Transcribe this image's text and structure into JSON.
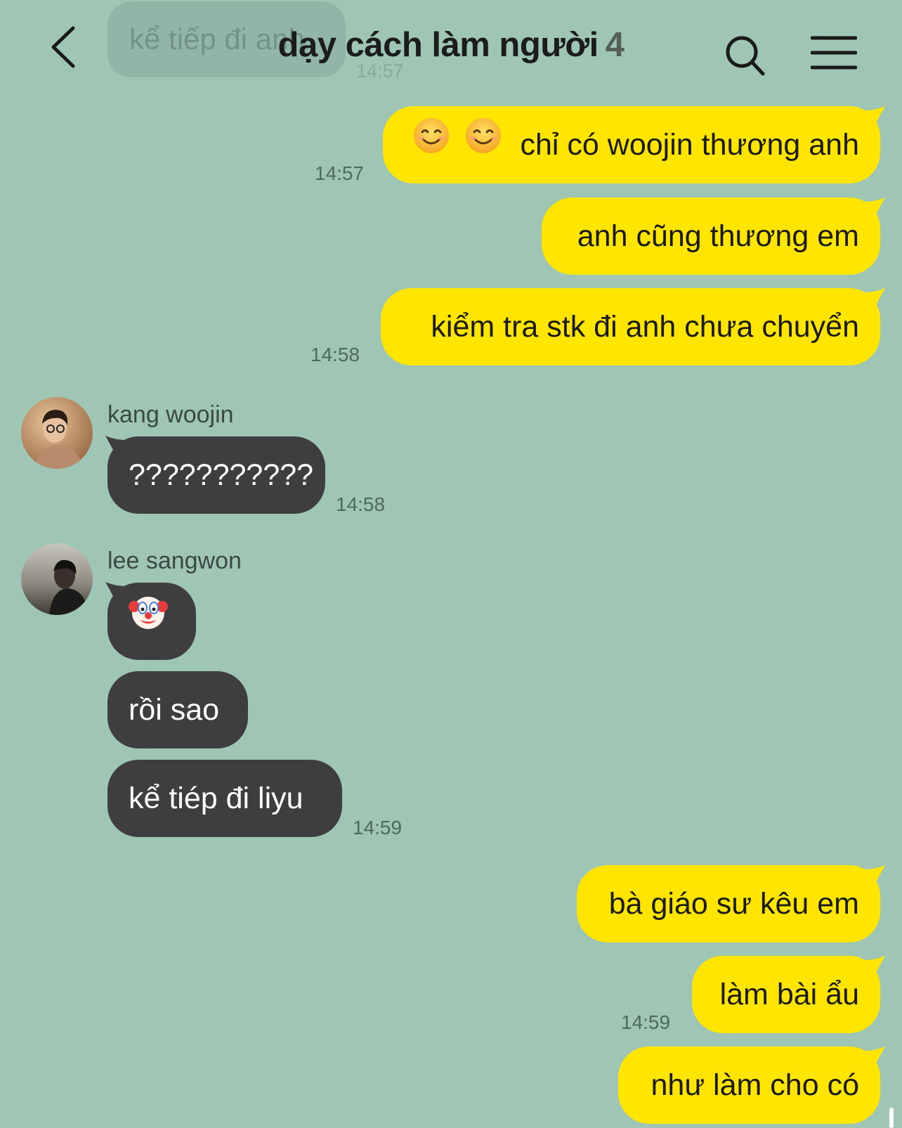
{
  "header": {
    "title": "dạy cách làm người",
    "member_count": "4",
    "ghost_message": "kể tiếp đi anh",
    "ghost_time": "14:57"
  },
  "colors": {
    "background": "#9fc6b5",
    "outgoing_bubble": "#ffe500",
    "incoming_bubble": "#3e3e40"
  },
  "icons": {
    "back": "chevron-left-icon",
    "search": "search-icon",
    "menu": "hamburger-menu-icon",
    "smile": "smiling-face-emoji",
    "clown": "clown-face-emoji"
  },
  "messages": [
    {
      "id": "m1",
      "direction": "out",
      "text": "chỉ có woojin thương anh",
      "emoji_prefix": "smiling-face-emoji x2",
      "time": "14:57"
    },
    {
      "id": "m2",
      "direction": "out",
      "text": "anh cũng thương em"
    },
    {
      "id": "m3",
      "direction": "out",
      "text": "kiểm tra stk đi anh chưa chuyển",
      "time": "14:58"
    },
    {
      "id": "m4",
      "direction": "in",
      "sender": "kang woojin",
      "text": "???????????",
      "time": "14:58"
    },
    {
      "id": "m5",
      "direction": "in",
      "sender": "lee sangwon",
      "emoji": "clown-face-emoji"
    },
    {
      "id": "m6",
      "direction": "in",
      "text": "rồi sao"
    },
    {
      "id": "m7",
      "direction": "in",
      "text": "kể tiép đi liyu",
      "time": "14:59"
    },
    {
      "id": "m8",
      "direction": "out",
      "text": "bà giáo sư kêu em"
    },
    {
      "id": "m9",
      "direction": "out",
      "text": "làm bài ẩu",
      "time": "14:59"
    },
    {
      "id": "m10",
      "direction": "out",
      "text": "như làm cho có"
    }
  ]
}
